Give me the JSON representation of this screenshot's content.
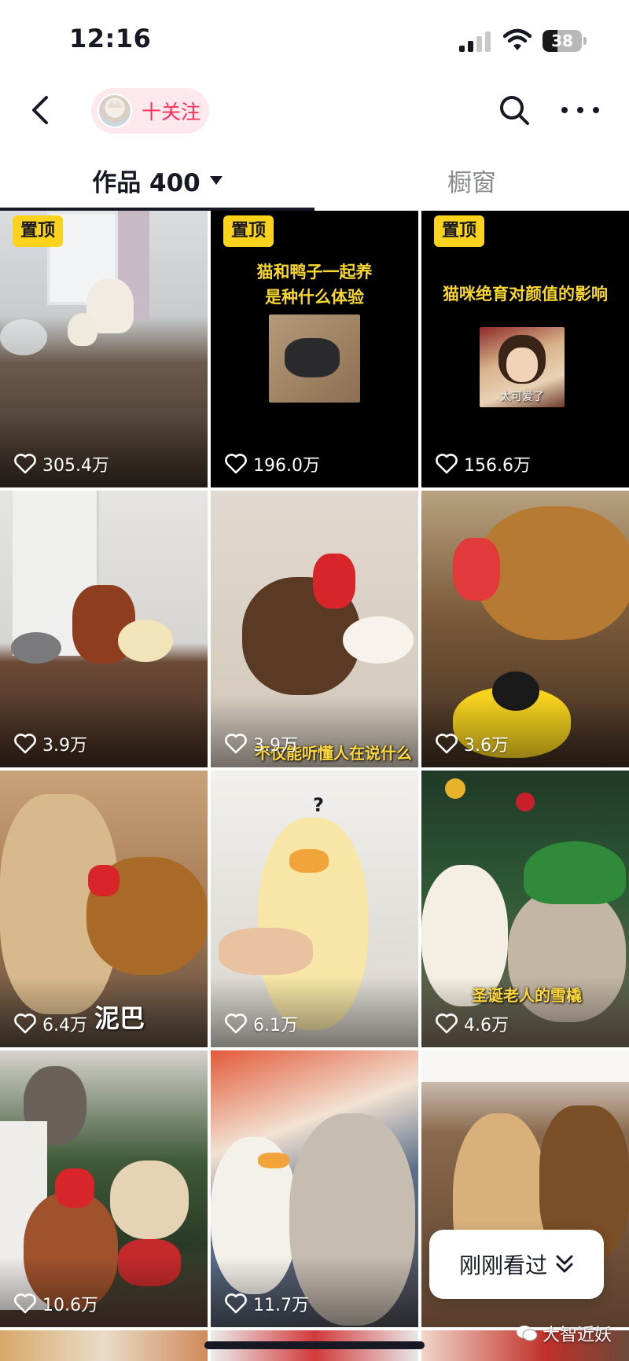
{
  "status_bar": {
    "time": "12:16",
    "battery": "38",
    "battery_level": 0.38,
    "icons": [
      "signal-icon",
      "wifi-icon",
      "battery-icon"
    ]
  },
  "header": {
    "back_icon": "chevron-left-icon",
    "follow_label": "十关注",
    "search_icon": "search-icon",
    "more_icon": "more-dots-icon"
  },
  "tabs": [
    {
      "label": "作品 400",
      "active": true,
      "has_dropdown": true
    },
    {
      "label": "橱窗",
      "active": false
    }
  ],
  "pin_label": "置顶",
  "videos": [
    {
      "likes": "305.4万",
      "pinned": true,
      "cover_title": ""
    },
    {
      "likes": "196.0万",
      "pinned": true,
      "cover_title_lines": [
        "猫和鸭子一起养",
        "是种什么体验"
      ]
    },
    {
      "likes": "156.6万",
      "pinned": true,
      "cover_title_lines": [
        "猫咪绝育对颜值的影响"
      ],
      "inset_caption": "太可爱了"
    },
    {
      "likes": "3.9万",
      "pinned": false
    },
    {
      "likes": "3.9万",
      "pinned": false,
      "caption": "不仅能听懂人在说什么"
    },
    {
      "likes": "3.6万",
      "pinned": false
    },
    {
      "likes": "6.4万",
      "pinned": false,
      "caption": "泥巴"
    },
    {
      "likes": "6.1万",
      "pinned": false,
      "caption": "?"
    },
    {
      "likes": "4.6万",
      "pinned": false,
      "caption": "圣诞老人的雪橇"
    },
    {
      "likes": "10.6万",
      "pinned": false
    },
    {
      "likes": "11.7万",
      "pinned": false
    },
    {
      "likes": "",
      "pinned": false
    }
  ],
  "floating": {
    "recent_label": "刚刚看过",
    "icon": "double-chevron-down-icon"
  },
  "watermark": "大智近妖",
  "colors": {
    "accent": "#fe2c55",
    "pin_badge": "#fbd31d",
    "cover_title": "#f7d62e"
  }
}
